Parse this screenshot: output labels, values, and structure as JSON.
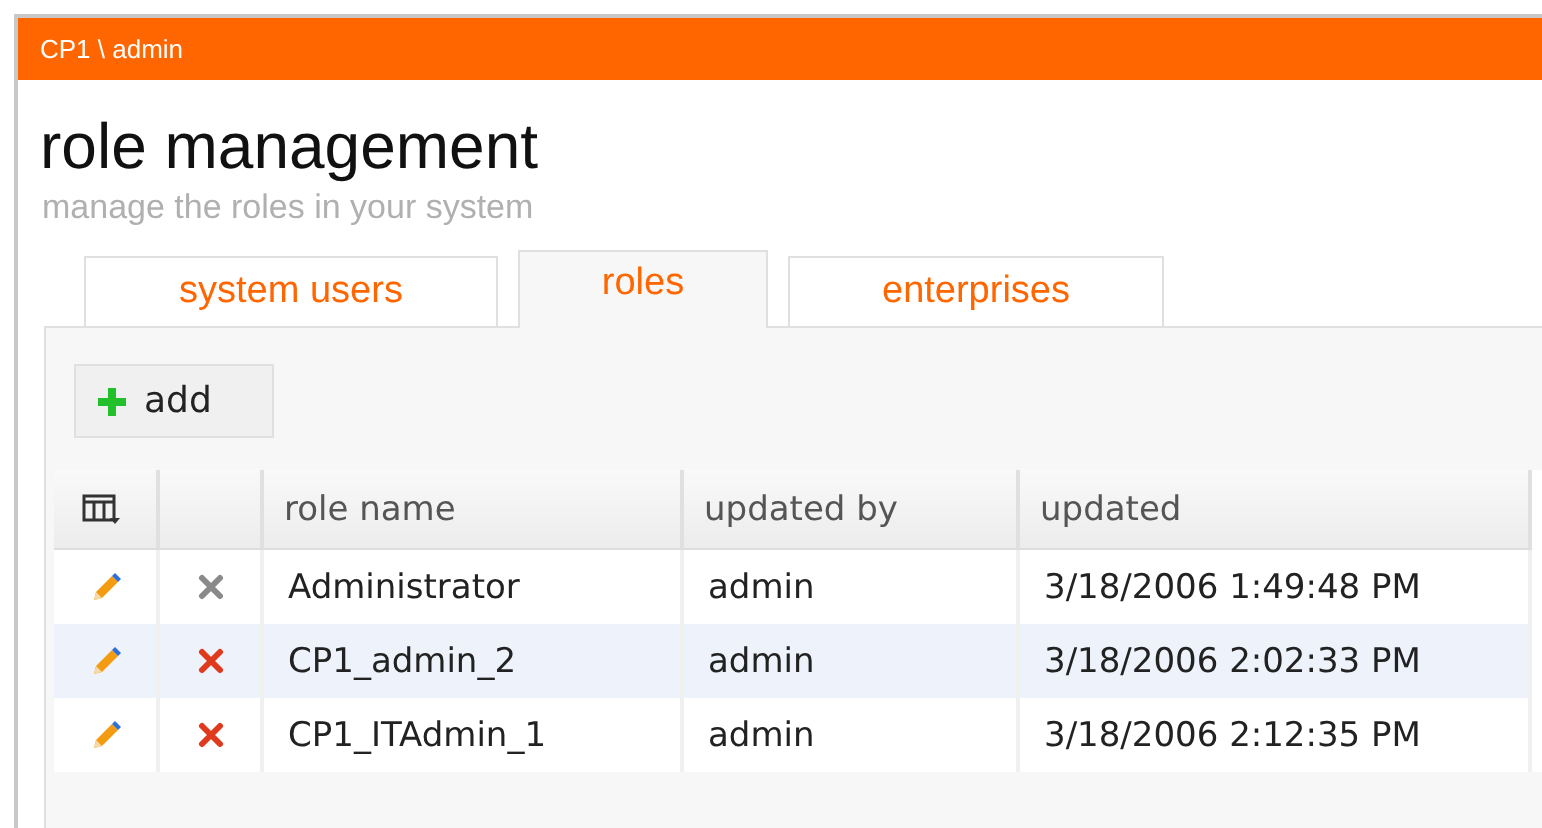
{
  "header": {
    "breadcrumb": "CP1 \\ admin"
  },
  "page": {
    "title": "role management",
    "subtitle": "manage the roles in your system"
  },
  "tabs": [
    {
      "label": "system users",
      "selected": false
    },
    {
      "label": "roles",
      "selected": true
    },
    {
      "label": "enterprises",
      "selected": false
    }
  ],
  "toolbar": {
    "add_button": "add"
  },
  "table": {
    "columns": [
      "role name",
      "updated by",
      "updated"
    ],
    "rows": [
      {
        "role_name": "Administrator",
        "updated_by": "admin",
        "updated": "3/18/2006 1:49:48 PM",
        "delete_disabled": true,
        "selected": false
      },
      {
        "role_name": "CP1_admin_2",
        "updated_by": "admin",
        "updated": "3/18/2006 2:02:33 PM",
        "delete_disabled": false,
        "selected": true
      },
      {
        "role_name": "CP1_ITAdmin_1",
        "updated_by": "admin",
        "updated": "3/18/2006 2:12:35 PM",
        "delete_disabled": false,
        "selected": false
      }
    ]
  }
}
